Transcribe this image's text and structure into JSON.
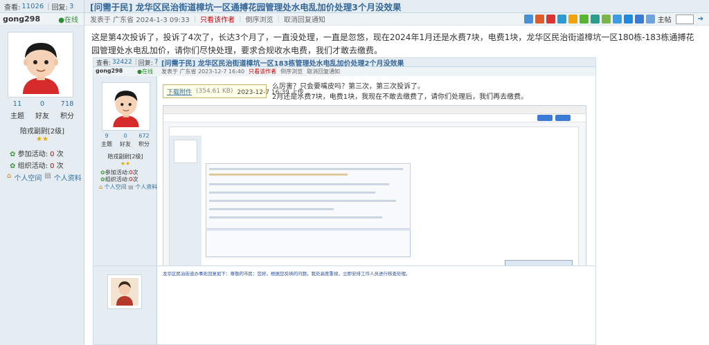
{
  "topbar": {
    "views_label": "查看:",
    "views": "11026",
    "replies_label": "回复:",
    "replies": "3",
    "title": "[问需于民] 龙华区民治街道樟坑一区通搏花园管理处水电乱加价处理3个月没效果"
  },
  "post": {
    "author": "gong298",
    "online": "在线",
    "published": "发表于 广东省 2024-1-3 09:33",
    "only_author": "只看该作者",
    "reverse": "倒序浏览",
    "unfollow": "取消回复通知",
    "floor_label": "主帖",
    "body": "这是第4次投诉了，投诉了4次了，长达3个月了，一直没处理，一直是忽悠，现在2024年1月还是水费7块，电费1块，龙华区民治街道樟坑一区180栋-183栋通搏花园管理处水电乱加价，请你们尽快处理，要求合规收水电费，我们才敢去缴费。"
  },
  "share_colors": [
    "#4a90d9",
    "#e05a2a",
    "#d33",
    "#2e9ad0",
    "#f2a20c",
    "#58b530",
    "#2a9d8f",
    "#7ab648",
    "#3b9ee0",
    "#1d8ae0",
    "#3a7bd5",
    "#6fa3e0"
  ],
  "user": {
    "threads": "11",
    "threads_label": "主题",
    "friends": "0",
    "friends_label": "好友",
    "points": "718",
    "points_label": "积分",
    "rank": "陪戎副尉[2级]",
    "stars": "★★",
    "attend_label": "参加活动:",
    "attend_count": "0",
    "attend_unit": "次",
    "organize_label": "组织活动:",
    "organize_count": "0",
    "organize_unit": "次",
    "space_link": "个人空间",
    "profile_link": "个人资料"
  },
  "embedded": {
    "views_label": "查看:",
    "views": "32422",
    "replies_label": "回复:",
    "replies": "7",
    "title": "[问需于民] 龙华区民治街道樟坑一区183栋管理处水电乱加价处理2个月没效果",
    "author": "gong298",
    "online": "在线",
    "published": "发表于 广东省 2023-12-7 16:40",
    "only_author": "只看该作者",
    "reverse": "倒序浏览",
    "unfollow": "取消回复通知",
    "text_line1": "么厉害？只会要嘴皮吗？第三次，第三次投诉了。",
    "text_line2": "2月还是水费7块，电费1块，我现在不敢去缴费了，请你们处理后，我们再去缴费。",
    "download_label": "下载附件",
    "download_size": "(354.61 KB)",
    "download_time": "2023-12-7 16:39 上传",
    "threads": "9",
    "threads_label": "主题",
    "friends": "0",
    "friends_label": "好友",
    "points": "672",
    "points_label": "积分",
    "rank": "陪戎副尉[2级]",
    "stars": "★★",
    "attend_label": "参加活动:",
    "attend_count": "0",
    "attend_unit": "次",
    "organize_label": "组织活动:",
    "organize_count": "0",
    "organize_unit": "次",
    "space_link": "个人空间",
    "profile_link": "个人资料",
    "lower_reply": "龙华区民治街道办事处回复如下：尊敬的市民：您好。根据您反映的问题，我处高度重视，立即安排工作人员进行核查处理。"
  }
}
